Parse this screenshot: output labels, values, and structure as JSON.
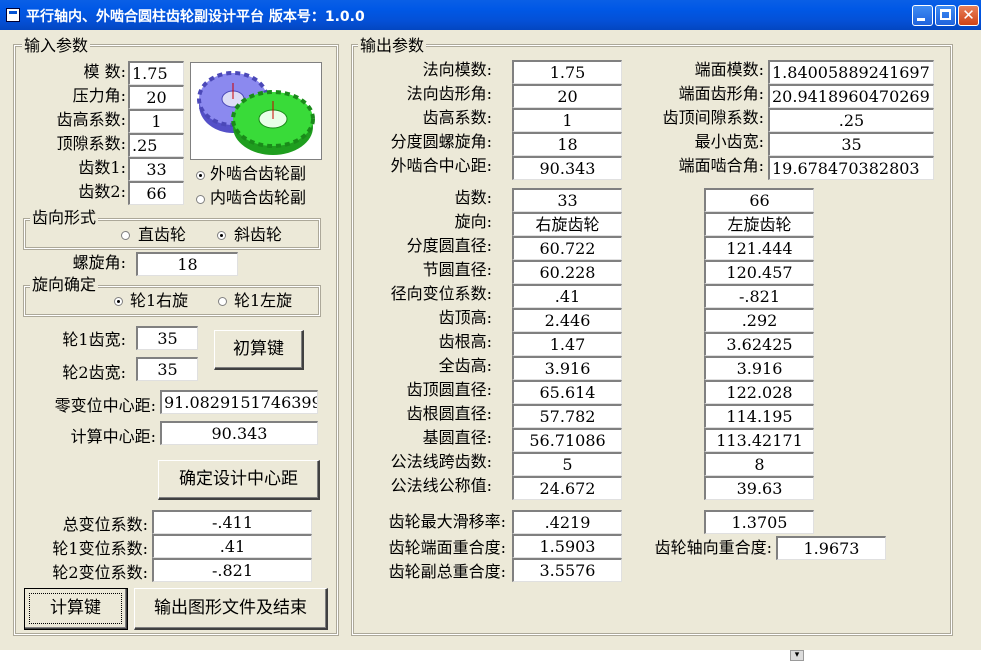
{
  "window": {
    "title": "平行轴内、外啮合圆柱齿轮副设计平台  版本号：1.0.0"
  },
  "input": {
    "legend": "输入参数",
    "modulus_label": "模    数:",
    "modulus": "1.75",
    "pressure_angle_label": "压力角:",
    "pressure_angle": "20",
    "addendum_coef_label": "齿高系数:",
    "addendum_coef": "1",
    "clearance_coef_label": "顶隙系数:",
    "clearance_coef": ".25",
    "teeth1_label": "齿数1:",
    "teeth1": "33",
    "teeth2_label": "齿数2:",
    "teeth2": "66",
    "mesh_external": "外啮合齿轮副",
    "mesh_internal": "内啮合齿轮副",
    "tooth_form_legend": "齿向形式",
    "spur": "直齿轮",
    "helical": "斜齿轮",
    "helix_angle_label": "螺旋角:",
    "helix_angle": "18",
    "hand_legend": "旋向确定",
    "gear1_right": "轮1右旋",
    "gear1_left": "轮1左旋",
    "width1_label": "轮1齿宽:",
    "width1": "35",
    "width2_label": "轮2齿宽:",
    "width2": "35",
    "init_calc_button": "初算键",
    "zero_shift_center_label": "零变位中心距:",
    "zero_shift_center": "91.0829151746399",
    "calc_center_label": "计算中心距:",
    "calc_center": "90.343",
    "confirm_center_button": "确定设计中心距",
    "total_shift_label": "总变位系数:",
    "total_shift": "-.411",
    "shift1_label": "轮1变位系数:",
    "shift1": ".41",
    "shift2_label": "轮2变位系数:",
    "shift2": "-.821",
    "calc_button": "计算键",
    "output_button": "输出图形文件及结束"
  },
  "output": {
    "legend": "输出参数",
    "normal_module_label": "法向模数:",
    "normal_module": "1.75",
    "normal_profile_label": "法向齿形角:",
    "normal_profile": "20",
    "addendum_coef_label": "齿高系数:",
    "addendum_coef": "1",
    "helix_label": "分度圆螺旋角:",
    "helix": "18",
    "ext_center_label": "外啮合中心距:",
    "ext_center": "90.343",
    "transverse_module_label": "端面模数:",
    "transverse_module": "1.84005889241697",
    "transverse_profile_label": "端面齿形角:",
    "transverse_profile": "20.9418960470269",
    "tip_clearance_label": "齿顶间隙系数:",
    "tip_clearance": ".25",
    "min_width_label": "最小齿宽:",
    "min_width": "35",
    "transverse_mesh_label": "端面啮合角:",
    "transverse_mesh": "19.678470382803",
    "rows": [
      {
        "label": "齿数:",
        "g1": "33",
        "g2": "66"
      },
      {
        "label": "旋向:",
        "g1": "右旋齿轮",
        "g2": "左旋齿轮"
      },
      {
        "label": "分度圆直径:",
        "g1": "60.722",
        "g2": "121.444"
      },
      {
        "label": "节圆直径:",
        "g1": "60.228",
        "g2": "120.457"
      },
      {
        "label": "径向变位系数:",
        "g1": ".41",
        "g2": "-.821"
      },
      {
        "label": "齿顶高:",
        "g1": "2.446",
        "g2": ".292"
      },
      {
        "label": "齿根高:",
        "g1": "1.47",
        "g2": "3.62425"
      },
      {
        "label": "全齿高:",
        "g1": "3.916",
        "g2": "3.916"
      },
      {
        "label": "齿顶圆直径:",
        "g1": "65.614",
        "g2": "122.028"
      },
      {
        "label": "齿根圆直径:",
        "g1": "57.782",
        "g2": "114.195"
      },
      {
        "label": "基圆直径:",
        "g1": "56.71086",
        "g2": "113.42171"
      },
      {
        "label": "公法线跨齿数:",
        "g1": "5",
        "g2": "8"
      },
      {
        "label": "公法线公称值:",
        "g1": "24.672",
        "g2": "39.63"
      }
    ],
    "max_slip_label": "齿轮最大滑移率:",
    "max_slip1": ".4219",
    "max_slip2": "1.3705",
    "transverse_overlap_label": "齿轮端面重合度:",
    "transverse_overlap": "1.5903",
    "axial_overlap_label": "齿轮轴向重合度:",
    "axial_overlap": "1.9673",
    "total_overlap_label": "齿轮副总重合度:",
    "total_overlap": "3.5576"
  },
  "icons": [
    "app-icon",
    "gear-pair-image",
    "minimize-icon",
    "maximize-icon",
    "close-icon",
    "chevron-down-icon"
  ],
  "colors": {
    "titlebar": "#0453d4",
    "face": "#ece9d8",
    "gear_blue": "#7a78e6",
    "gear_green": "#2fd12f"
  }
}
